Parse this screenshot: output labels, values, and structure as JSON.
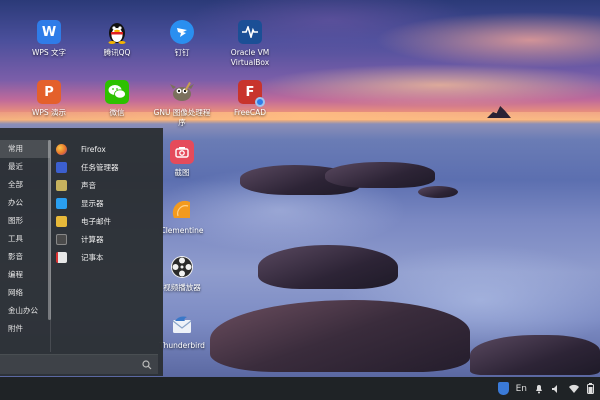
{
  "desktop": {
    "icons": [
      {
        "label": "WPS 文字",
        "glyph": "W",
        "icon": "wps-writer-icon",
        "color": "#2f7ce8"
      },
      {
        "label": "腾讯QQ",
        "glyph": "",
        "icon": "qq-penguin-icon",
        "color": "#111111"
      },
      {
        "label": "钉钉",
        "glyph": "",
        "icon": "dingtalk-icon",
        "color": "#2a8ff0"
      },
      {
        "label": "Oracle VM VirtualBox",
        "glyph": "",
        "icon": "virtualbox-icon",
        "color": "#1b4f96"
      },
      {
        "label": "WPS 演示",
        "glyph": "P",
        "icon": "wps-presentation-icon",
        "color": "#e4602b"
      },
      {
        "label": "微信",
        "glyph": "",
        "icon": "wechat-icon",
        "color": "#2dc100"
      },
      {
        "label": "GNU 图像处理程序",
        "glyph": "",
        "icon": "gimp-icon",
        "color": "#6b6455"
      },
      {
        "label": "FreeCAD",
        "glyph": "F",
        "icon": "freecad-icon",
        "color": "#c8342c"
      },
      {
        "label": "截图",
        "glyph": "",
        "icon": "screenshot-camera-icon",
        "color": "#e54b5b"
      },
      {
        "label": "Clementine",
        "glyph": "",
        "icon": "clementine-orange-icon",
        "color": "#f39a1e"
      },
      {
        "label": "视频播放器",
        "glyph": "",
        "icon": "video-reel-icon",
        "color": "#333333"
      },
      {
        "label": "Thunderbird",
        "glyph": "",
        "icon": "thunderbird-icon",
        "color": "#3a78c8"
      }
    ]
  },
  "start_menu": {
    "categories": [
      "常用",
      "最近",
      "全部",
      "办公",
      "图形",
      "工具",
      "影音",
      "编程",
      "网络",
      "金山办公",
      "附件"
    ],
    "active_category": "常用",
    "apps": [
      {
        "label": "Firefox",
        "icon": "firefox-icon",
        "color": "#e8742a"
      },
      {
        "label": "任务管理器",
        "icon": "task-manager-icon",
        "color": "#3c5fcf"
      },
      {
        "label": "声音",
        "icon": "sound-icon",
        "color": "#c7b25e"
      },
      {
        "label": "显示器",
        "icon": "display-monitor-icon",
        "color": "#2a9ff0"
      },
      {
        "label": "电子邮件",
        "icon": "email-icon",
        "color": "#e8b93a"
      },
      {
        "label": "计算器",
        "icon": "calculator-icon",
        "color": "#4a4a4a"
      },
      {
        "label": "记事本",
        "icon": "notepad-icon",
        "color": "#e8e8e8"
      }
    ],
    "search": {
      "placeholder": ""
    }
  },
  "taskbar": {
    "tray": {
      "language": "En",
      "icons": [
        "security-shield-icon",
        "notification-bell-icon",
        "volume-icon",
        "network-wifi-icon",
        "battery-icon"
      ]
    }
  },
  "colors": {
    "menu_bg": "#2c3034",
    "taskbar_bg": "#1f2326",
    "accent": "#2f7ce8"
  }
}
